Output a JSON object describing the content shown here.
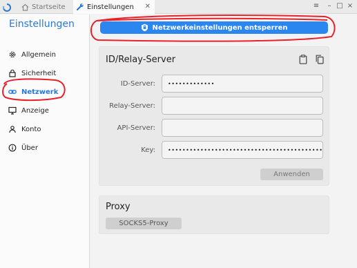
{
  "tabs": [
    {
      "label": "Startseite",
      "icon": "home-icon",
      "active": false
    },
    {
      "label": "Einstellungen",
      "icon": "wrench-icon",
      "active": true
    }
  ],
  "window_controls": {
    "menu": "≡",
    "minimize": "–",
    "maximize": "□",
    "close": "×"
  },
  "sidebar": {
    "title": "Einstellungen",
    "items": [
      {
        "label": "Allgemein",
        "icon": "gear-icon"
      },
      {
        "label": "Sicherheit",
        "icon": "lock-icon"
      },
      {
        "label": "Netzwerk",
        "icon": "link-icon",
        "active": true
      },
      {
        "label": "Anzeige",
        "icon": "monitor-icon"
      },
      {
        "label": "Konto",
        "icon": "person-icon"
      },
      {
        "label": "Über",
        "icon": "info-icon"
      }
    ]
  },
  "main": {
    "unlock_button": "Netzwerkeinstellungen entsperren",
    "relay_card": {
      "title": "ID/Relay-Server",
      "fields": [
        {
          "label": "ID-Server:",
          "value": "•••••••••••••"
        },
        {
          "label": "Relay-Server:",
          "value": ""
        },
        {
          "label": "API-Server:",
          "value": ""
        },
        {
          "label": "Key:",
          "value": "•••••••••••••••••••••••••••••••••••••••••••••"
        }
      ],
      "apply_button": "Anwenden"
    },
    "proxy_card": {
      "title": "Proxy",
      "button": "SOCKS5-Proxy"
    }
  },
  "colors": {
    "accent": "#2a78d6",
    "button_blue": "#2b86f0",
    "annotation_red": "#e8202a"
  }
}
